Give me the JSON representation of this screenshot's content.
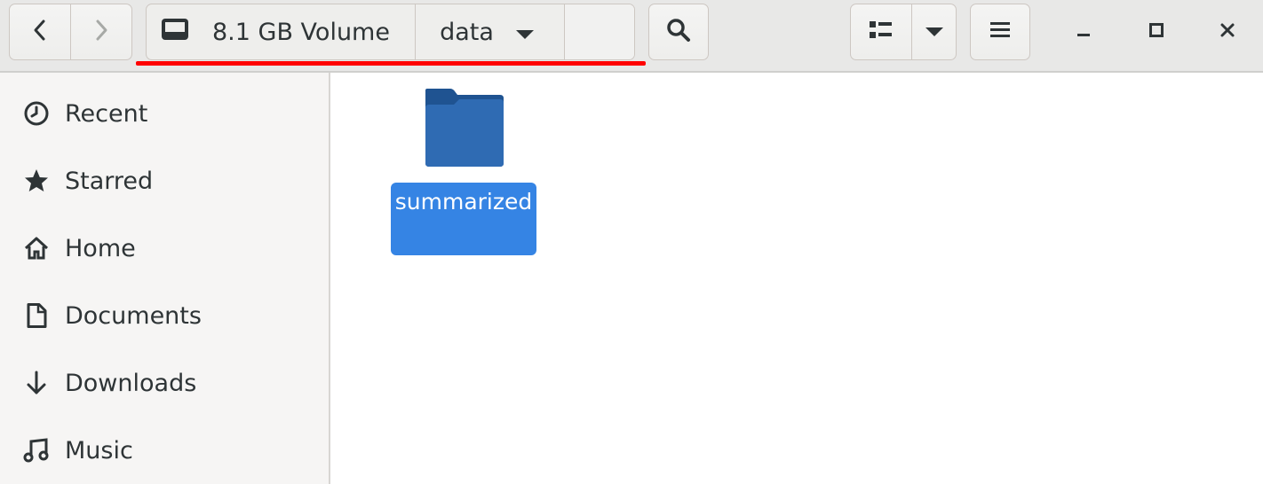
{
  "header": {
    "path": {
      "volume_label": "8.1 GB Volume",
      "current_label": "data"
    }
  },
  "sidebar": {
    "items": [
      {
        "label": "Recent",
        "icon": "clock-icon"
      },
      {
        "label": "Starred",
        "icon": "star-icon"
      },
      {
        "label": "Home",
        "icon": "home-icon"
      },
      {
        "label": "Documents",
        "icon": "document-icon"
      },
      {
        "label": "Downloads",
        "icon": "download-icon"
      },
      {
        "label": "Music",
        "icon": "music-icon"
      }
    ]
  },
  "content": {
    "items": [
      {
        "name": "summarized",
        "type": "folder",
        "selected": true
      }
    ]
  },
  "colors": {
    "accent": "#3584e4",
    "folder": "#2a64a8",
    "annotation_underline": "#ff0000"
  }
}
